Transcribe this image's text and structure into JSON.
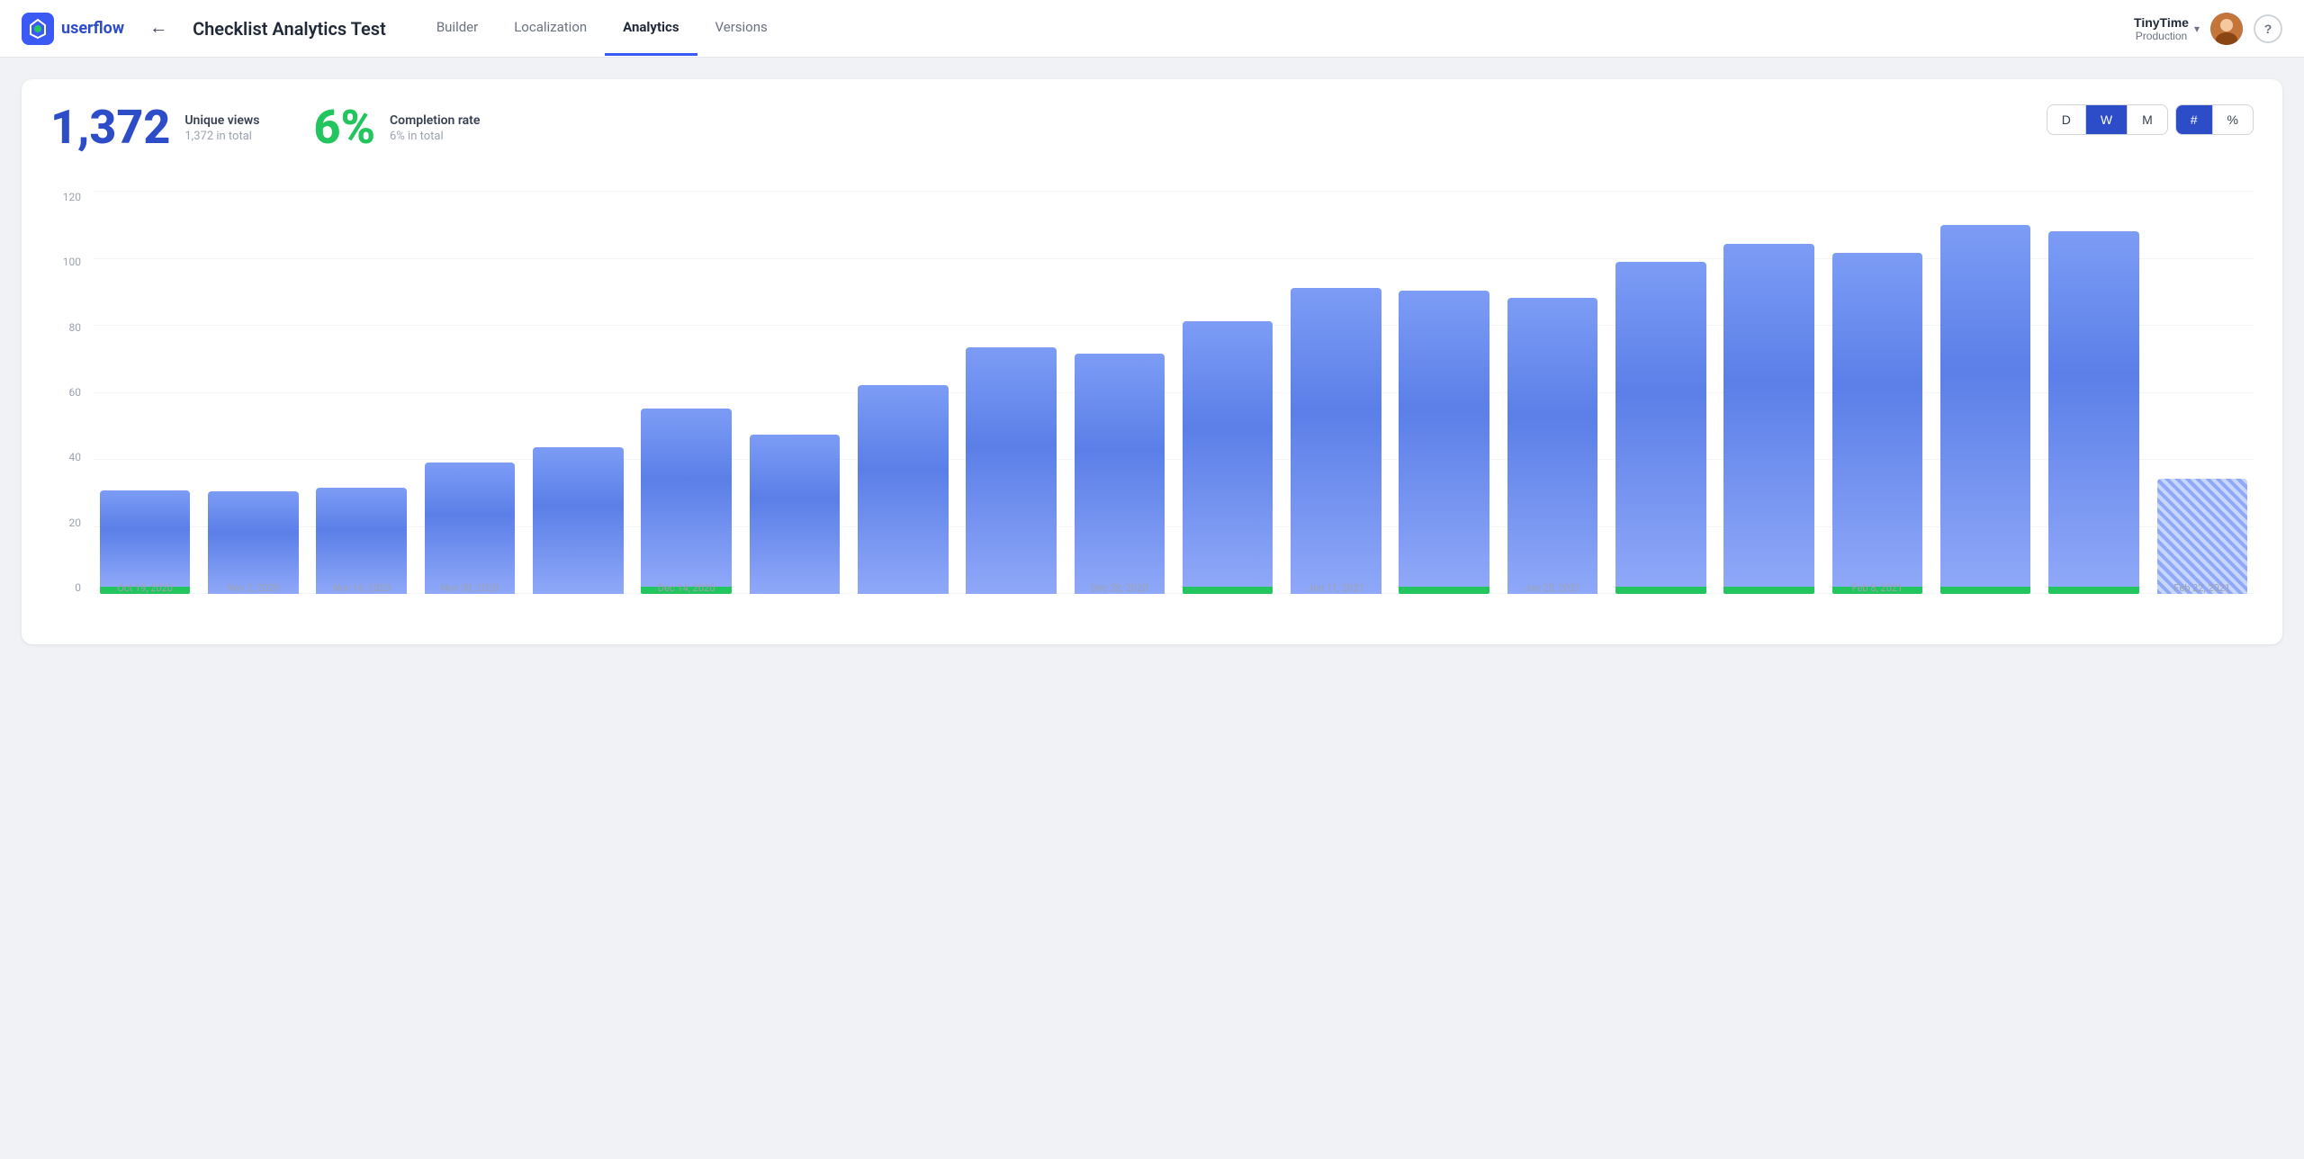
{
  "header": {
    "logo_text": "userflow",
    "back_label": "←",
    "page_title": "Checklist Analytics Test",
    "nav": [
      {
        "label": "Builder",
        "active": false
      },
      {
        "label": "Localization",
        "active": false
      },
      {
        "label": "Analytics",
        "active": true
      },
      {
        "label": "Versions",
        "active": false
      }
    ],
    "workspace": {
      "name": "TinyTime",
      "env": "Production",
      "chevron": "▾"
    },
    "help_label": "?"
  },
  "stats": {
    "unique_views": {
      "number": "1,372",
      "label": "Unique views",
      "sublabel": "1,372 in total"
    },
    "completion_rate": {
      "number": "6%",
      "label": "Completion rate",
      "sublabel": "6% in total"
    }
  },
  "controls": {
    "period_buttons": [
      "D",
      "W",
      "M"
    ],
    "active_period": "W",
    "type_buttons": [
      "#",
      "%"
    ],
    "active_type": "#"
  },
  "chart": {
    "y_labels": [
      "0",
      "20",
      "40",
      "60",
      "80",
      "100",
      "120"
    ],
    "max_value": 120,
    "bars": [
      {
        "label": "Oct 19, 2020",
        "value": 31,
        "green": true,
        "striped": false
      },
      {
        "label": "Nov 2, 2020",
        "value": 33,
        "green": false,
        "striped": false
      },
      {
        "label": "Nov 16, 2020",
        "value": 34,
        "green": false,
        "striped": false
      },
      {
        "label": "Nov 30, 2020",
        "value": 42,
        "green": false,
        "striped": false
      },
      {
        "label": "",
        "value": 47,
        "green": false,
        "striped": false
      },
      {
        "label": "Dec 14, 2020",
        "value": 57,
        "green": true,
        "striped": false
      },
      {
        "label": "",
        "value": 51,
        "green": false,
        "striped": false
      },
      {
        "label": "",
        "value": 67,
        "green": false,
        "striped": false
      },
      {
        "label": "",
        "value": 79,
        "green": false,
        "striped": false
      },
      {
        "label": "Dec 28, 2020",
        "value": 77,
        "green": false,
        "striped": false
      },
      {
        "label": "",
        "value": 85,
        "green": true,
        "striped": false
      },
      {
        "label": "Jan 11, 2021",
        "value": 98,
        "green": false,
        "striped": false
      },
      {
        "label": "",
        "value": 95,
        "green": true,
        "striped": false
      },
      {
        "label": "Jan 25, 2021",
        "value": 95,
        "green": false,
        "striped": false
      },
      {
        "label": "",
        "value": 104,
        "green": true,
        "striped": false
      },
      {
        "label": "",
        "value": 110,
        "green": true,
        "striped": false
      },
      {
        "label": "Feb 8, 2021",
        "value": 107,
        "green": true,
        "striped": false
      },
      {
        "label": "",
        "value": 116,
        "green": true,
        "striped": false
      },
      {
        "label": "",
        "value": 114,
        "green": true,
        "striped": false
      },
      {
        "label": "Feb 22, 2021",
        "value": 37,
        "green": false,
        "striped": true
      }
    ]
  }
}
